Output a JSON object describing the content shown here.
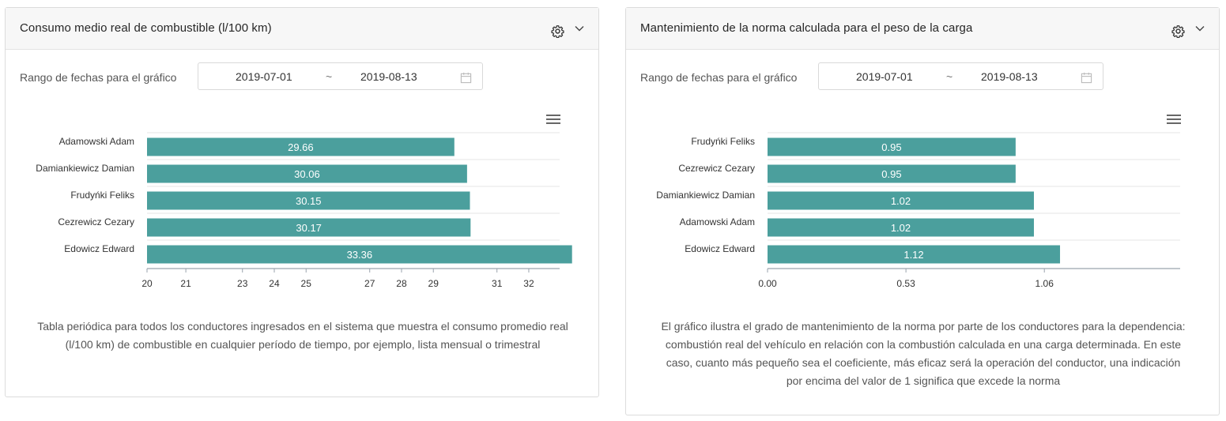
{
  "bar_color": "#4b9f9d",
  "panels": [
    {
      "title": "Consumo medio real de combustible (l/100 km)",
      "range_label": "Rango de fechas para el gráfico",
      "range_start": "2019-07-01",
      "range_separator": "~",
      "range_end": "2019-08-13",
      "description": "Tabla periódica para todos los conductores ingresados en el sistema que muestra el consumo promedio real (l/100 km) de combustible en cualquier período de tiempo, por ejemplo, lista mensual o trimestral"
    },
    {
      "title": "Mantenimiento de la norma calculada para el peso de la carga",
      "range_label": "Rango de fechas para el gráfico",
      "range_start": "2019-07-01",
      "range_separator": "~",
      "range_end": "2019-08-13",
      "description": "El gráfico ilustra el grado de mantenimiento de la norma por parte de los conductores para la dependencia: combustión real del vehículo en relación con la combustión calculada en una carga determinada. En este caso, cuanto más pequeño sea el coeficiente, más eficaz será la operación del conductor, una indicación por encima del valor de 1 significa que excede la norma"
    }
  ],
  "chart_data": [
    {
      "type": "bar",
      "orientation": "horizontal",
      "categories": [
        "Adamowski Adam",
        "Damiankiewicz Damian",
        "Frudyńki Feliks",
        "Cezrewicz Cezary",
        "Edowicz Edward"
      ],
      "values": [
        29.66,
        30.06,
        30.15,
        30.17,
        33.36
      ],
      "value_labels": [
        "29.66",
        "30.06",
        "30.15",
        "30.17",
        "33.36"
      ],
      "xlim": [
        20,
        32.97
      ],
      "ticks": [
        20,
        21.22,
        23,
        24,
        25,
        27,
        28,
        29,
        31,
        32
      ],
      "tick_labels": [
        "20",
        "21",
        "23",
        "24",
        "25",
        "27",
        "28",
        "29",
        "31",
        "32"
      ]
    },
    {
      "type": "bar",
      "orientation": "horizontal",
      "categories": [
        "Frudyńki Feliks",
        "Cezrewicz Cezary",
        "Damiankiewicz Damian",
        "Adamowski Adam",
        "Edowicz Edward"
      ],
      "values": [
        0.95,
        0.95,
        1.02,
        1.02,
        1.12
      ],
      "value_labels": [
        "0.95",
        "0.95",
        "1.02",
        "1.02",
        "1.12"
      ],
      "xlim": [
        0,
        1.58
      ],
      "ticks": [
        0,
        0.53,
        1.06
      ],
      "tick_labels": [
        "0.00",
        "0.53",
        "1.06"
      ]
    }
  ]
}
